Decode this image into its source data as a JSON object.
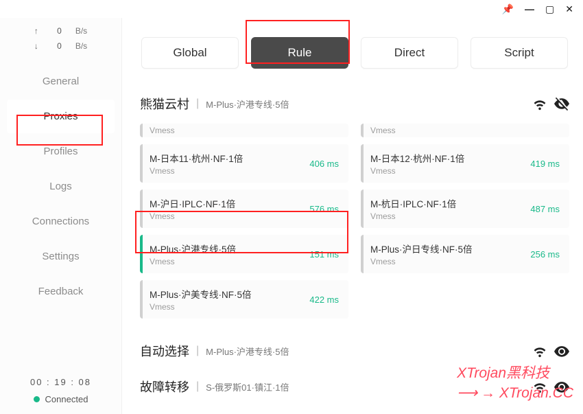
{
  "titlebar": {
    "pin": "📌",
    "min": "—",
    "max": "▢",
    "close": "✕"
  },
  "sidebar": {
    "speed": {
      "up_arrow": "↑",
      "up_val": "0",
      "up_unit": "B/s",
      "down_arrow": "↓",
      "down_val": "0",
      "down_unit": "B/s"
    },
    "nav": [
      {
        "label": "General",
        "active": false
      },
      {
        "label": "Proxies",
        "active": true
      },
      {
        "label": "Profiles",
        "active": false
      },
      {
        "label": "Logs",
        "active": false
      },
      {
        "label": "Connections",
        "active": false
      },
      {
        "label": "Settings",
        "active": false
      },
      {
        "label": "Feedback",
        "active": false
      }
    ],
    "status": {
      "time": "00 : 19 : 08",
      "text": "Connected"
    }
  },
  "tabs": [
    {
      "label": "Global",
      "active": false
    },
    {
      "label": "Rule",
      "active": true
    },
    {
      "label": "Direct",
      "active": false
    },
    {
      "label": "Script",
      "active": false
    }
  ],
  "groups": [
    {
      "name": "熊猫云村",
      "selected": "M-Plus·沪港专线·5倍",
      "eye": "hidden",
      "proxies": [
        {
          "col": 0,
          "cut": true,
          "title": "",
          "type": "Vmess",
          "lat": "",
          "selected": false
        },
        {
          "col": 1,
          "cut": true,
          "title": "",
          "type": "Vmess",
          "lat": "",
          "selected": false
        },
        {
          "col": 0,
          "title": "M-日本11·杭州·NF·1倍",
          "type": "Vmess",
          "lat": "406 ms",
          "selected": false
        },
        {
          "col": 1,
          "title": "M-日本12·杭州·NF·1倍",
          "type": "Vmess",
          "lat": "419 ms",
          "selected": false
        },
        {
          "col": 0,
          "title": "M-沪日·IPLC·NF·1倍",
          "type": "Vmess",
          "lat": "576 ms",
          "selected": false
        },
        {
          "col": 1,
          "title": "M-杭日·IPLC·NF·1倍",
          "type": "Vmess",
          "lat": "487 ms",
          "selected": false
        },
        {
          "col": 0,
          "title": "M-Plus·沪港专线·5倍",
          "type": "Vmess",
          "lat": "151 ms",
          "selected": true
        },
        {
          "col": 1,
          "title": "M-Plus·沪日专线·NF·5倍",
          "type": "Vmess",
          "lat": "256 ms",
          "selected": false
        },
        {
          "col": 0,
          "title": "M-Plus·沪美专线·NF·5倍",
          "type": "Vmess",
          "lat": "422 ms",
          "selected": false
        }
      ]
    },
    {
      "name": "自动选择",
      "selected": "M-Plus·沪港专线·5倍",
      "eye": "visible"
    },
    {
      "name": "故障转移",
      "selected": "S-俄罗斯01·镇江·1倍",
      "eye": "visible"
    }
  ],
  "watermark": {
    "line1": "XTrojan黑科技",
    "line2": "→ XTrojan.CC"
  },
  "colors": {
    "accent": "#19b989",
    "tab_active": "#4a4a4a",
    "highlight": "#ff2020"
  }
}
